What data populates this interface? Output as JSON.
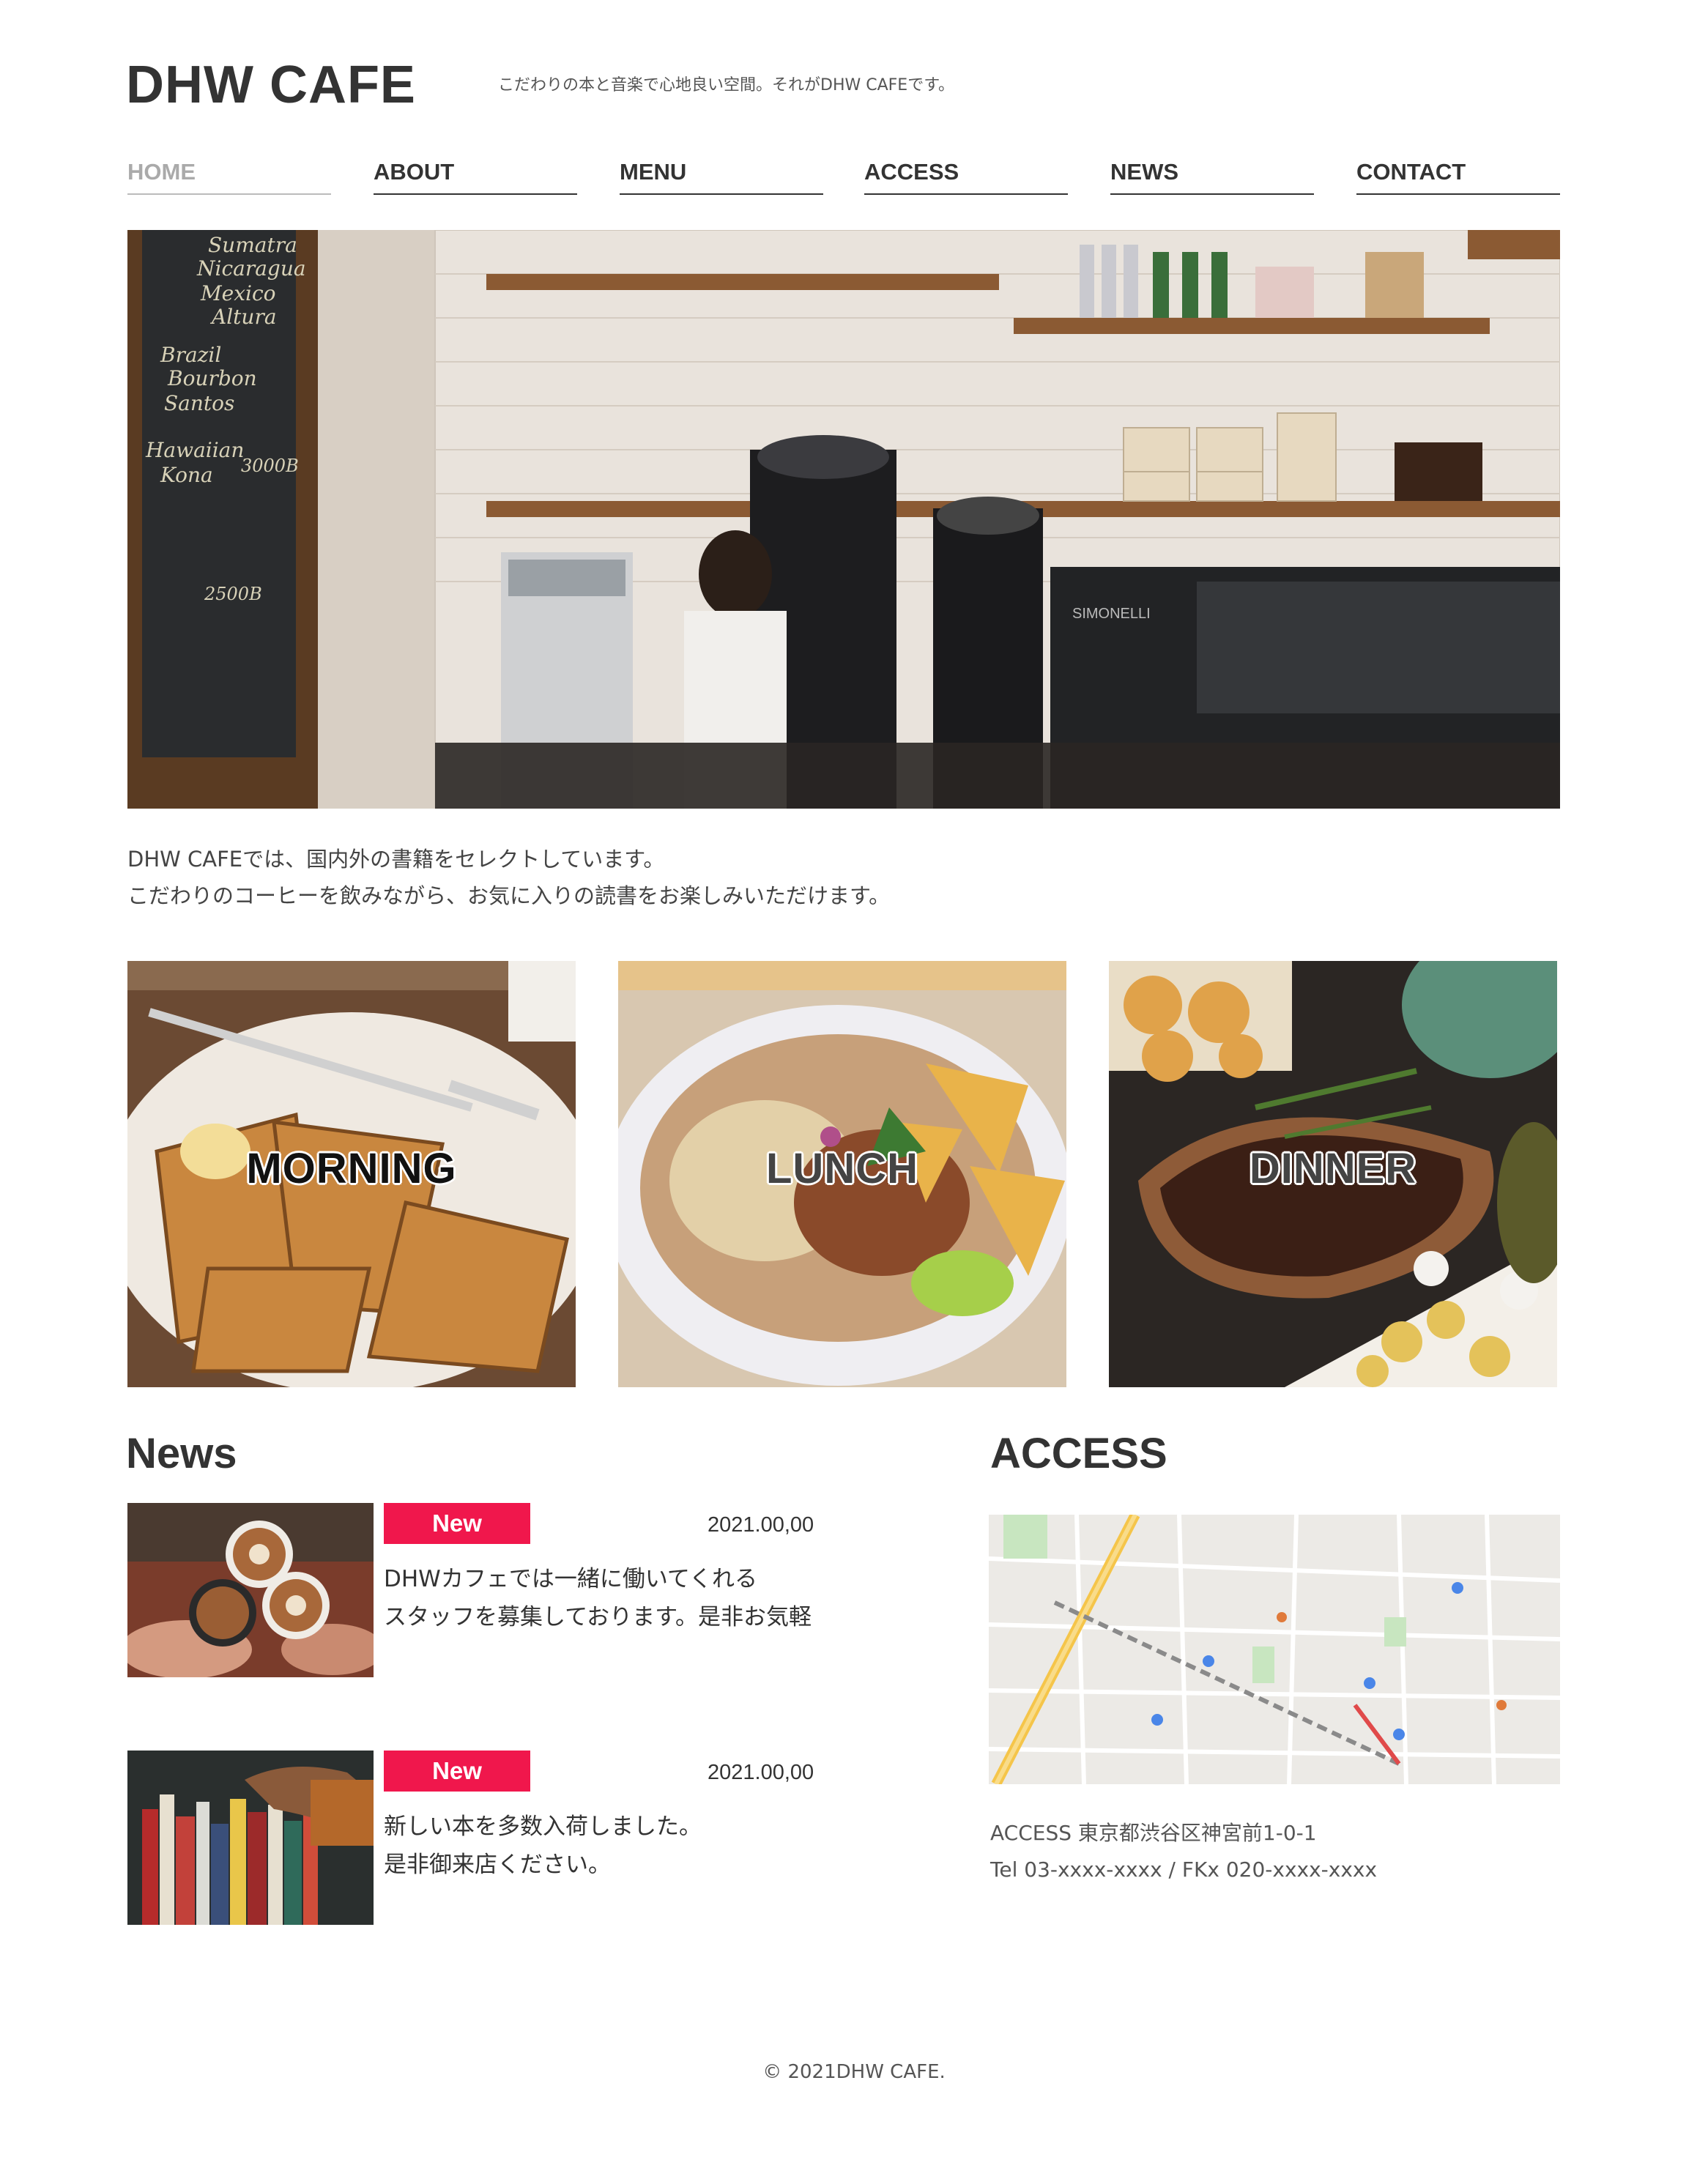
{
  "site": {
    "logo": "DHW CAFE",
    "tagline": "こだわりの本と音楽で心地良い空間。それがDHW CAFEです。"
  },
  "nav": {
    "active": "HOME",
    "items": [
      {
        "label": "HOME"
      },
      {
        "label": "ABOUT"
      },
      {
        "label": "MENU"
      },
      {
        "label": "ACCESS"
      },
      {
        "label": "NEWS"
      },
      {
        "label": "CONTACT"
      }
    ]
  },
  "hero": {
    "chalkboard_lines": [
      "Sumatra",
      "Nicaragua",
      "Mexico",
      "Altura",
      "Brazil",
      "Bourbon",
      "Santos",
      "Hawaiian",
      "Kona",
      "2500B",
      "3000B"
    ],
    "machine_brand": "SIMONELLI"
  },
  "intro": {
    "line1": "DHW CAFEでは、国内外の書籍をセレクトしています。",
    "line2": "こだわりのコーヒーを飲みながら、お気に入りの読書をお楽しみいただけます。"
  },
  "menu": {
    "tiles": [
      {
        "label": "MORNING",
        "icon": "french-toast-photo"
      },
      {
        "label": "LUNCH",
        "icon": "rice-bowl-photo"
      },
      {
        "label": "DINNER",
        "icon": "roast-meat-photo"
      }
    ]
  },
  "news": {
    "title": "News",
    "items": [
      {
        "badge": "New",
        "date": "2021.00,00",
        "line1": "DHWカフェでは一緒に働いてくれる",
        "line2": "スタッフを募集しております。是非お気軽",
        "icon": "latte-cups-photo"
      },
      {
        "badge": "New",
        "date": "2021.00,00",
        "line1": "新しい本を多数入荷しました。",
        "line2": "是非御来店ください。",
        "icon": "bookshelf-photo"
      }
    ]
  },
  "access": {
    "title": "ACCESS",
    "address": "ACCESS 東京都渋谷区神宮前1-0-1",
    "tel": "Tel 03-xxxx-xxxx / FKx 020-xxxx-xxxx",
    "map_icon": "street-map"
  },
  "footer": {
    "copyright": "© 2021DHW CAFE."
  },
  "colors": {
    "accent": "#f0174c",
    "text": "#333333",
    "nav_inactive": "#aaaaaa"
  }
}
